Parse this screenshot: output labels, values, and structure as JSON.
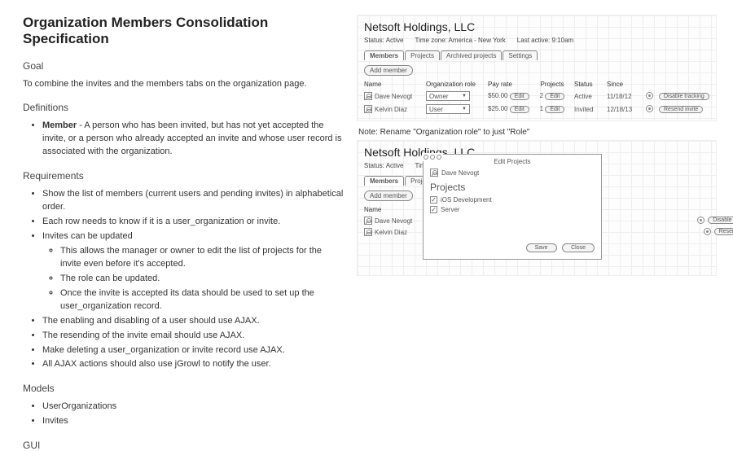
{
  "title": "Organization Members Consolidation Specification",
  "goal": {
    "heading": "Goal",
    "text": "To combine the invites and the members tabs on the organization page."
  },
  "definitions": {
    "heading": "Definitions",
    "member_label": "Member",
    "member_text": " - A person who has been invited, but has not yet accepted the invite, or a person who already accepted an invite and whose user record is associated with the organization."
  },
  "requirements": {
    "heading": "Requirements",
    "items": [
      "Show the list of members (current users and pending invites) in alphabetical order.",
      "Each row needs to know if it is a user_organization or invite.",
      "Invites can be updated",
      "The enabling and disabling of a user should use AJAX.",
      "The resending of the invite email should use AJAX.",
      "Make deleting a user_organization or invite record use AJAX.",
      "All AJAX actions should also use jGrowl to notify the user."
    ],
    "sub": [
      "This allows the manager or owner to edit the list of projects for the invite even before it's accepted.",
      "The role can be updated.",
      "Once the invite is accepted its data should be used to set up the user_organization record."
    ]
  },
  "models": {
    "heading": "Models",
    "items": [
      "UserOrganizations",
      "Invites"
    ]
  },
  "gui_heading": "GUI",
  "note": "Note: Rename \"Organization role\" to just \"Role\"",
  "wire": {
    "orgname": "Netsoft Holdings, LLC",
    "status_label": "Status:",
    "status_value": "Active",
    "tz_label": "Time zone:",
    "tz_value": "America - New York",
    "last_label": "Last active:",
    "last_value": "9:10am",
    "tabs": [
      "Members",
      "Projects",
      "Archived projects",
      "Settings"
    ],
    "add_member": "Add member",
    "cols": {
      "name": "Name",
      "role": "Organization role",
      "pay": "Pay rate",
      "projects": "Projects",
      "status": "Status",
      "since": "Since"
    },
    "rows": [
      {
        "name": "Dave Nevogt",
        "role": "Owner",
        "pay": "$50.00",
        "edit": "Edit",
        "proj": "2",
        "pedit": "Edit",
        "status": "Active",
        "since": "11/18/12",
        "action": "Disable tracking"
      },
      {
        "name": "Kelvin Diaz",
        "role": "User",
        "pay": "$25.00",
        "edit": "Edit",
        "proj": "1",
        "pedit": "Edit",
        "status": "Invited",
        "since": "12/18/13",
        "action": "Resend invite"
      }
    ]
  },
  "modal": {
    "title": "Edit Projects",
    "user": "Dave Nevogt",
    "heading": "Projects",
    "items": [
      "iOS Development",
      "Server"
    ],
    "save": "Save",
    "close": "Close"
  }
}
